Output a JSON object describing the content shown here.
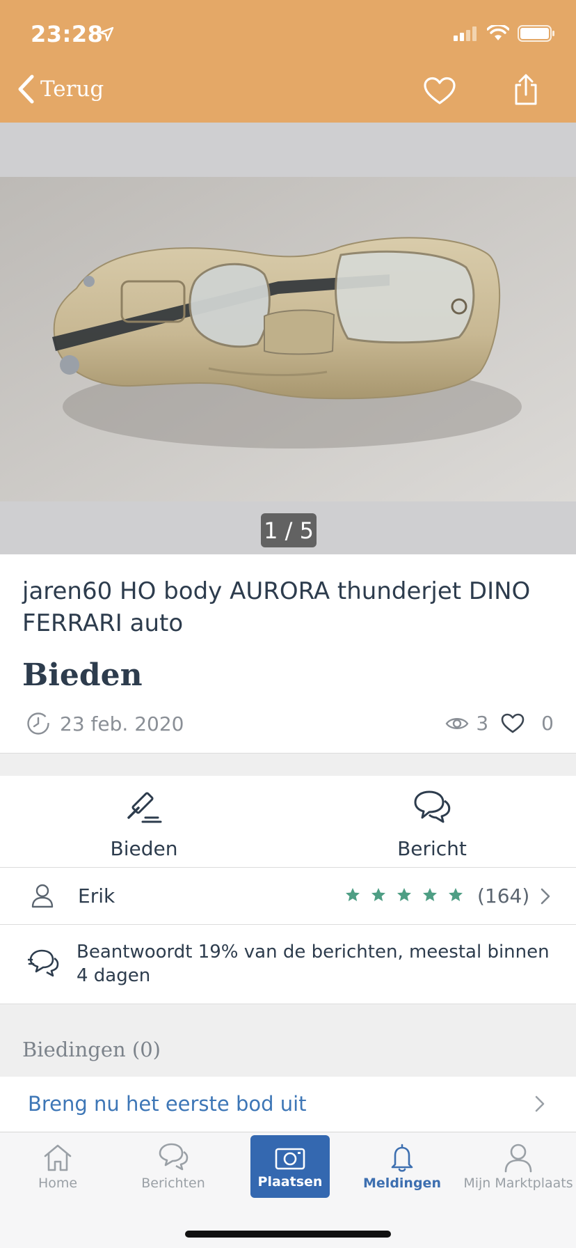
{
  "status_bar": {
    "time": "23:28"
  },
  "nav": {
    "back_label": "Terug"
  },
  "gallery": {
    "counter": "1 / 5"
  },
  "listing": {
    "title": "jaren60 HO body AURORA thunderjet DINO FERRARI auto",
    "price": "Bieden",
    "date": "23 feb. 2020",
    "views": "3",
    "favorites": "0"
  },
  "actions": {
    "bid_label": "Bieden",
    "message_label": "Bericht"
  },
  "seller": {
    "name": "Erik",
    "rating_stars": 5,
    "rating_count": "(164)"
  },
  "response": {
    "text": "Beantwoordt 19% van de berichten, meestal binnen 4 dagen"
  },
  "bids": {
    "header": "Biedingen (0)",
    "cta": "Breng nu het eerste bod uit"
  },
  "tabbar": {
    "home": "Home",
    "messages": "Berichten",
    "place": "Plaatsen",
    "notifications": "Meldingen",
    "my": "Mijn Marktplaats"
  },
  "colors": {
    "brand_orange": "#e4a867",
    "accent_blue": "#3468b0",
    "link_blue": "#3d76b6",
    "star_green": "#4e9e84"
  }
}
